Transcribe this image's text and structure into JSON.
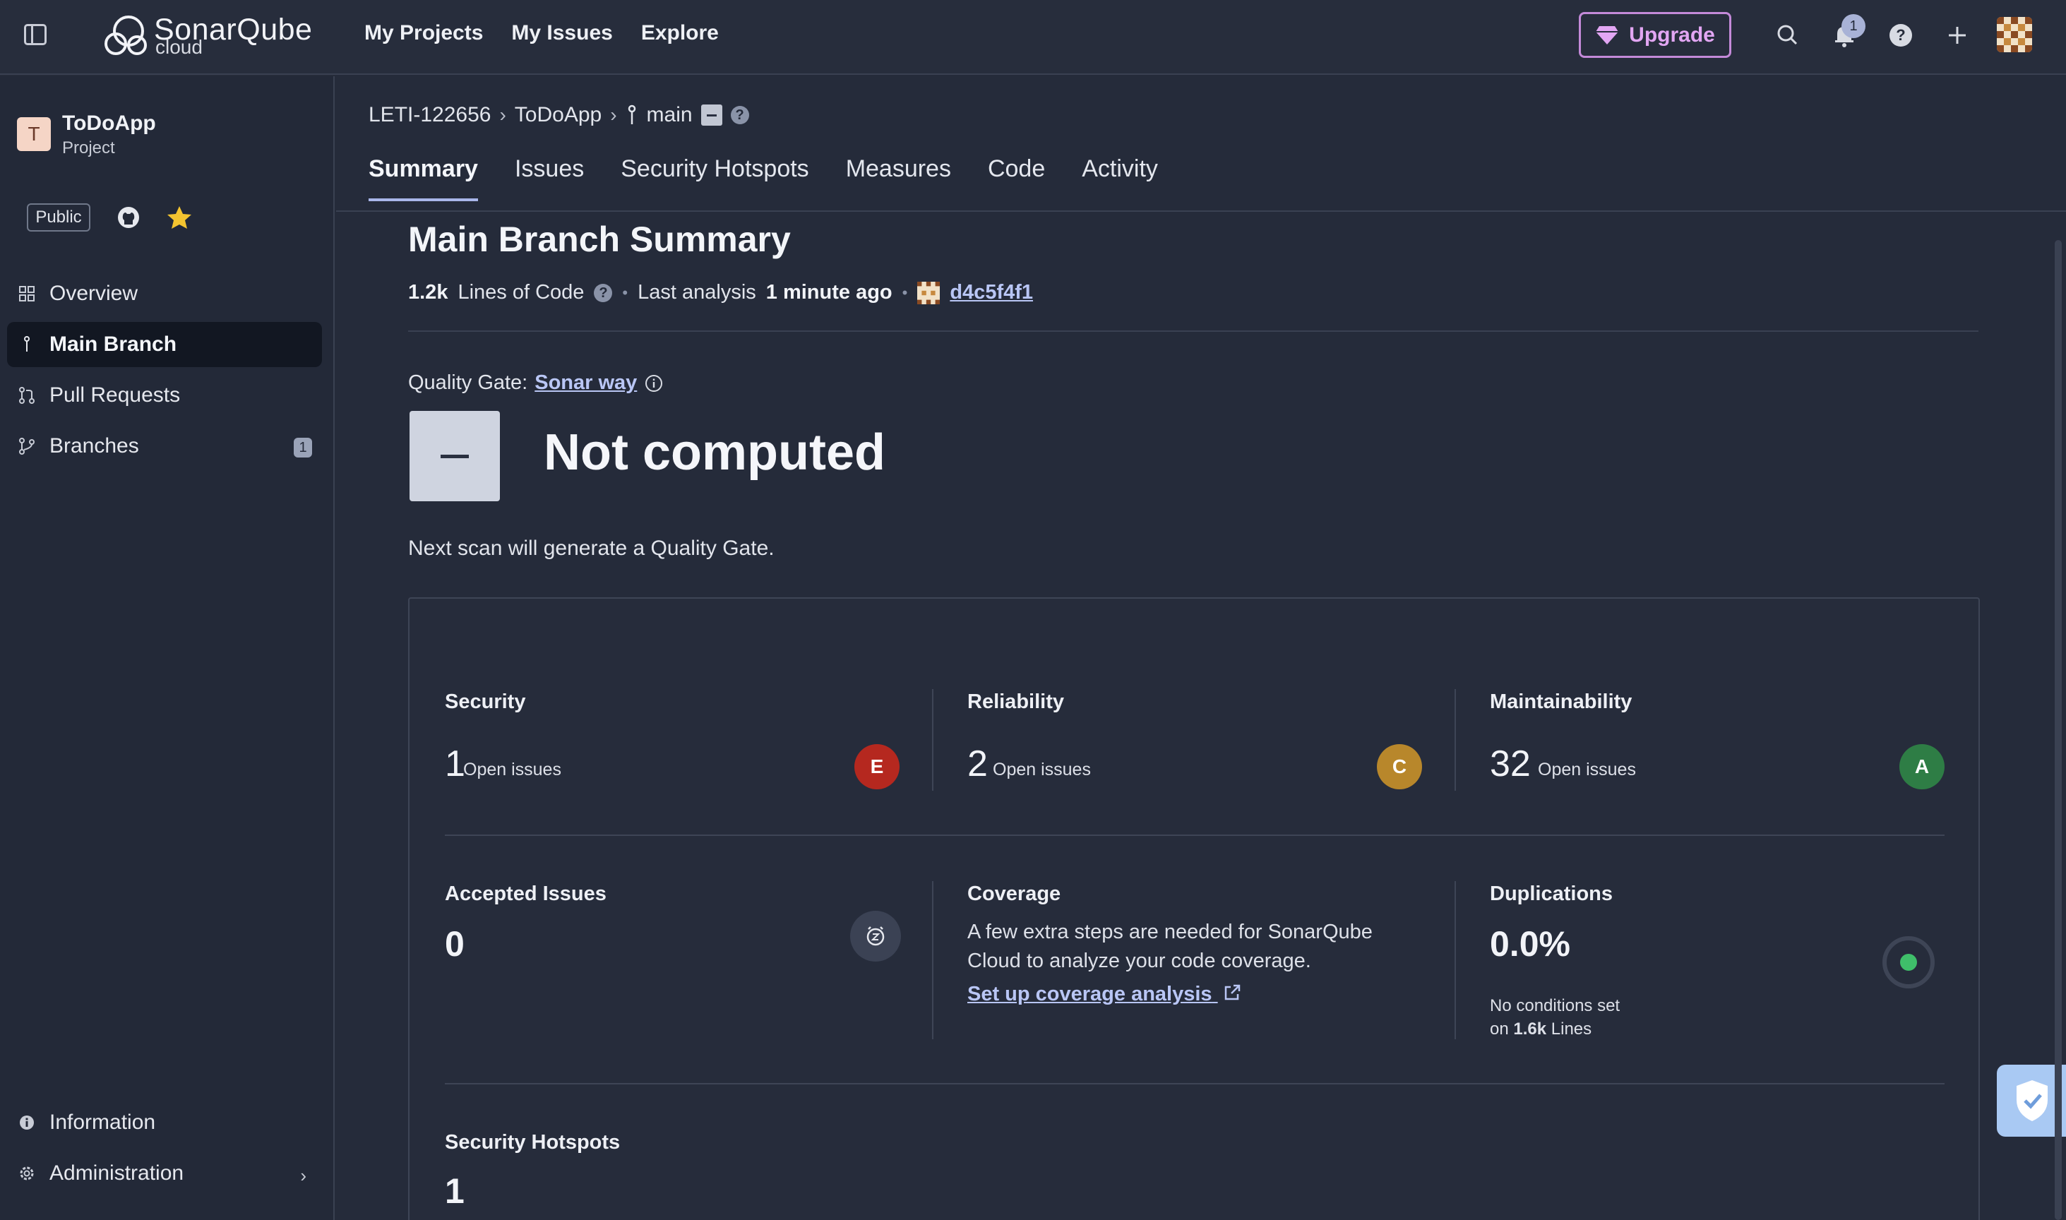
{
  "topbar": {
    "logo_name": "SonarQube",
    "logo_sub": "cloud",
    "nav": [
      "My Projects",
      "My Issues",
      "Explore"
    ],
    "upgrade_label": "Upgrade",
    "notification_count": "1"
  },
  "sidebar": {
    "project_initial": "T",
    "project_name": "ToDoApp",
    "project_type": "Project",
    "visibility": "Public",
    "items": [
      {
        "label": "Overview",
        "icon": "grid-icon"
      },
      {
        "label": "Main Branch",
        "icon": "branch-icon"
      },
      {
        "label": "Pull Requests",
        "icon": "pull-request-icon"
      },
      {
        "label": "Branches",
        "icon": "branches-icon",
        "count": "1"
      }
    ],
    "bottom": [
      {
        "label": "Information",
        "icon": "info-icon"
      },
      {
        "label": "Administration",
        "icon": "gear-icon"
      }
    ]
  },
  "breadcrumb": {
    "org": "LETI-122656",
    "project": "ToDoApp",
    "branch": "main"
  },
  "tabs": [
    "Summary",
    "Issues",
    "Security Hotspots",
    "Measures",
    "Code",
    "Activity"
  ],
  "summary": {
    "title": "Main Branch Summary",
    "loc_value": "1.2k",
    "loc_label": "Lines of Code",
    "last_analysis_label": "Last analysis",
    "last_analysis_value": "1 minute ago",
    "commit": "d4c5f4f1"
  },
  "quality_gate": {
    "label": "Quality Gate:",
    "name": "Sonar way",
    "status": "Not computed",
    "note": "Next scan will generate a Quality Gate."
  },
  "metrics": {
    "security": {
      "title": "Security",
      "value": "1",
      "sub": "Open issues",
      "grade": "E",
      "color": "#b5281f"
    },
    "reliability": {
      "title": "Reliability",
      "value": "2",
      "sub": "Open issues",
      "grade": "C",
      "color": "#b8872b"
    },
    "maintainability": {
      "title": "Maintainability",
      "value": "32",
      "sub": "Open issues",
      "grade": "A",
      "color": "#2e7d45"
    },
    "accepted": {
      "title": "Accepted Issues",
      "value": "0"
    },
    "coverage": {
      "title": "Coverage",
      "text": "A few extra steps are needed for SonarQube Cloud to analyze your code coverage.",
      "link": "Set up coverage analysis"
    },
    "duplications": {
      "title": "Duplications",
      "value": "0.0%",
      "note_line1": "No conditions set",
      "note_on": "on",
      "note_lines_value": "1.6k",
      "note_lines_label": "Lines"
    },
    "hotspots": {
      "title": "Security Hotspots",
      "value": "1"
    }
  }
}
